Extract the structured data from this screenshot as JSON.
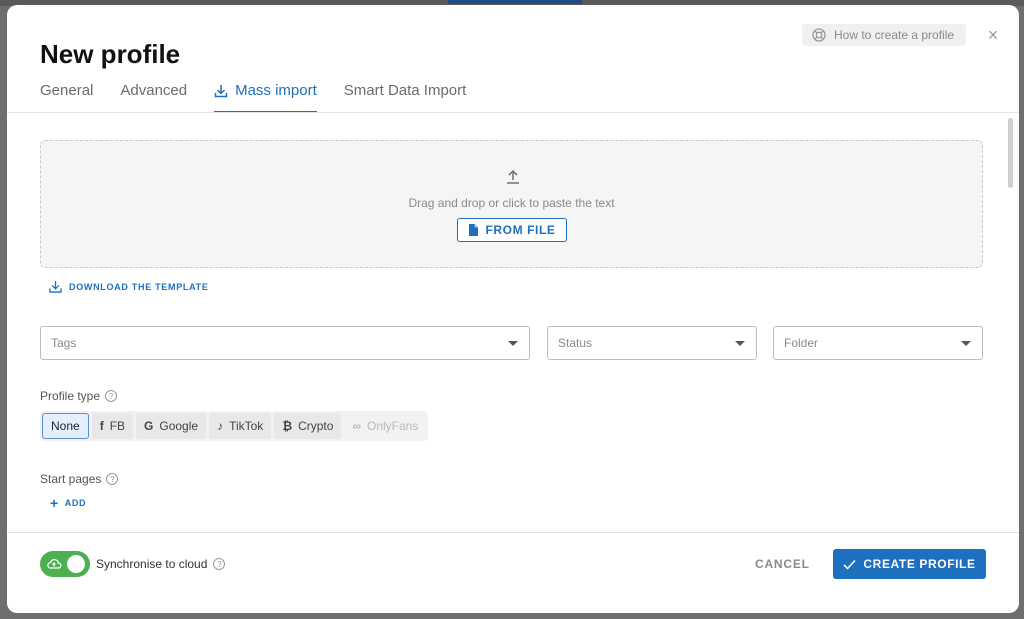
{
  "dialog": {
    "title": "New profile",
    "help_link": "How to create a profile",
    "close_label": "×"
  },
  "tabs": [
    {
      "label": "General",
      "active": false
    },
    {
      "label": "Advanced",
      "active": false
    },
    {
      "label": "Mass import",
      "active": true,
      "icon": "download-icon"
    },
    {
      "label": "Smart Data Import",
      "active": false
    }
  ],
  "dropzone": {
    "text": "Drag and drop or click to paste the text",
    "button_label": "FROM FILE",
    "icon": "upload-icon"
  },
  "download_template_label": "DOWNLOAD THE TEMPLATE",
  "selects": {
    "tags_placeholder": "Tags",
    "status_placeholder": "Status",
    "folder_placeholder": "Folder"
  },
  "profile_type": {
    "label": "Profile type",
    "options": [
      {
        "label": "None",
        "selected": true
      },
      {
        "label": "FB",
        "glyph": "f"
      },
      {
        "label": "Google",
        "glyph": "G"
      },
      {
        "label": "TikTok",
        "glyph": "♪"
      },
      {
        "label": "Crypto",
        "glyph": "₿"
      },
      {
        "label": "OnlyFans",
        "glyph": "∞",
        "disabled": true
      }
    ]
  },
  "start_pages": {
    "label": "Start pages",
    "add_label": "ADD"
  },
  "footer": {
    "sync_label": "Synchronise to cloud",
    "sync_enabled": true,
    "cancel_label": "CANCEL",
    "create_label": "CREATE PROFILE"
  },
  "colors": {
    "accent": "#1f6fbf",
    "toggle_on": "#4caf50"
  }
}
